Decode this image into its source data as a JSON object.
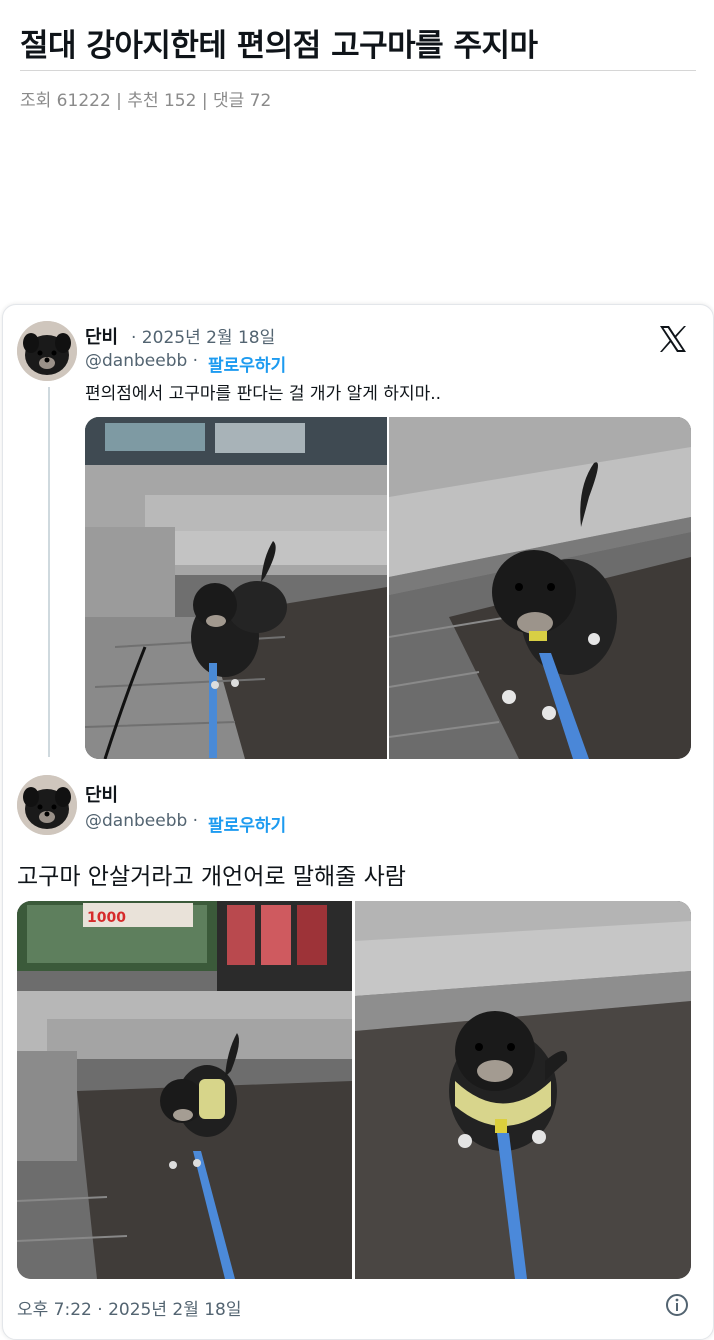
{
  "post": {
    "title": "절대 강아지한테 편의점 고구마를 주지마",
    "meta": "조회 61222 | 추천 152 | 댓글 72"
  },
  "tweet1": {
    "name": "단비",
    "date": "· 2025년 2월 18일",
    "handle": "@danbeebb ·",
    "follow": "팔로우하기",
    "text": "편의점에서 고구마를 판다는 걸 개가 알게 하지마..",
    "images": [
      "dog-photo",
      "dog-photo"
    ]
  },
  "tweet2": {
    "name": "단비",
    "handle": "@danbeebb ·",
    "follow": "팔로우하기",
    "text": "고구마 안살거라고 개언어로 말해줄 사람",
    "images": [
      "dog-photo",
      "dog-photo"
    ],
    "timestamp": "오후 7:22 · 2025년 2월 18일"
  },
  "icons": {
    "platform": "x-logo-icon",
    "info": "info-icon"
  },
  "colors": {
    "link": "#1d9bf0",
    "secondary_text": "#536471",
    "meta_text": "#8a8a8a"
  },
  "photo_overlay_text": [
    "1000"
  ]
}
